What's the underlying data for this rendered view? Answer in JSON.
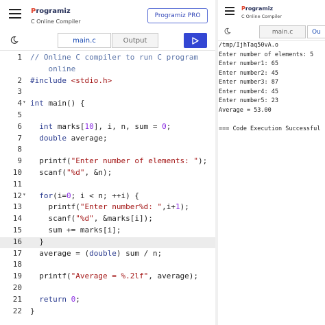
{
  "app": {
    "brand": "rogramiz",
    "brand_mark": "P",
    "subtitle": "C Online Compiler",
    "pro_button": "Programiz PRO"
  },
  "tabs": {
    "main": "main.c",
    "output": "Output"
  },
  "icons": {
    "menu": "hamburger-icon",
    "theme": "moon-icon",
    "run": "play-icon"
  },
  "colors": {
    "accent": "#3346d3",
    "brand": "#252f58",
    "brand_mark": "#e0452f"
  },
  "editor": {
    "active_line": 16,
    "lines": [
      {
        "num": "1",
        "fold": "",
        "text": "// Online C compiler to run C program"
      },
      {
        "num": "",
        "fold": "",
        "text": "    online"
      },
      {
        "num": "2",
        "fold": "",
        "text": "#include <stdio.h>"
      },
      {
        "num": "3",
        "fold": "",
        "text": ""
      },
      {
        "num": "4",
        "fold": "▾",
        "text": "int main() {"
      },
      {
        "num": "5",
        "fold": "",
        "text": ""
      },
      {
        "num": "6",
        "fold": "",
        "text": "  int marks[10], i, n, sum = 0;"
      },
      {
        "num": "7",
        "fold": "",
        "text": "  double average;"
      },
      {
        "num": "8",
        "fold": "",
        "text": ""
      },
      {
        "num": "9",
        "fold": "",
        "text": "  printf(\"Enter number of elements: \");"
      },
      {
        "num": "10",
        "fold": "",
        "text": "  scanf(\"%d\", &n);"
      },
      {
        "num": "11",
        "fold": "",
        "text": ""
      },
      {
        "num": "12",
        "fold": "▾",
        "text": "  for(i=0; i < n; ++i) {"
      },
      {
        "num": "13",
        "fold": "",
        "text": "    printf(\"Enter number%d: \",i+1);"
      },
      {
        "num": "14",
        "fold": "",
        "text": "    scanf(\"%d\", &marks[i]);"
      },
      {
        "num": "15",
        "fold": "",
        "text": "    sum += marks[i];"
      },
      {
        "num": "16",
        "fold": "",
        "text": "  }"
      },
      {
        "num": "17",
        "fold": "",
        "text": "  average = (double) sum / n;"
      },
      {
        "num": "18",
        "fold": "",
        "text": ""
      },
      {
        "num": "19",
        "fold": "",
        "text": "  printf(\"Average = %.2lf\", average);"
      },
      {
        "num": "20",
        "fold": "",
        "text": ""
      },
      {
        "num": "21",
        "fold": "",
        "text": "  return 0;"
      },
      {
        "num": "22",
        "fold": "",
        "text": "}"
      }
    ]
  },
  "right_panel": {
    "brand": "rogramiz",
    "brand_mark": "P",
    "subtitle": "C Online Compiler",
    "tab_main": "main.c",
    "tab_output": "Ou",
    "output_lines": [
      "/tmp/IjhTaq50vA.o",
      "Enter number of elements: 5",
      "Enter number1: 65",
      "Enter number2: 45",
      "Enter number3: 87",
      "Enter number4: 45",
      "Enter number5: 23",
      "Average = 53.00",
      "",
      "=== Code Execution Successful"
    ]
  }
}
